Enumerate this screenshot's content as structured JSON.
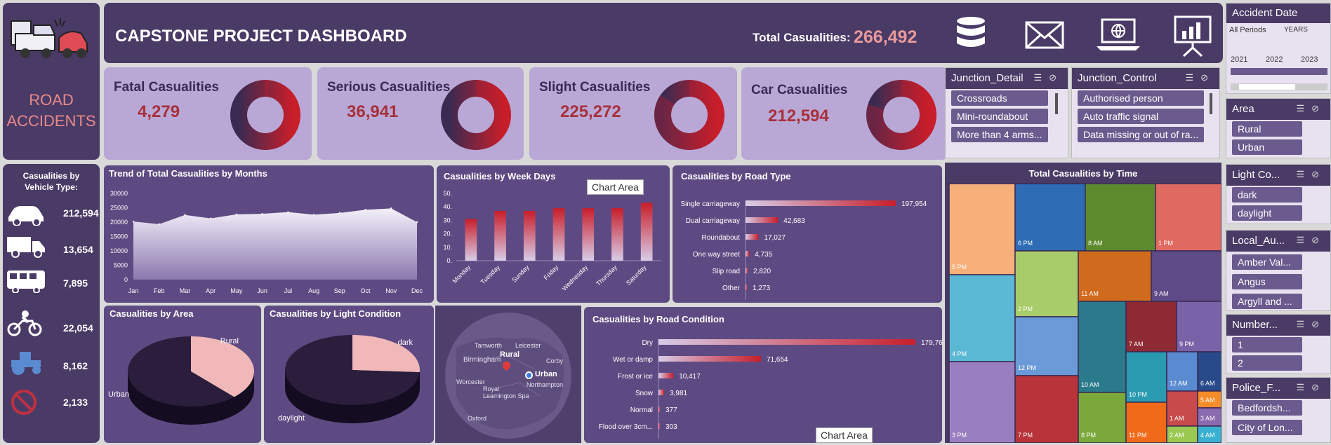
{
  "header": {
    "title": "CAPSTONE PROJECT DASHBOARD",
    "total_label": "Total Casualities:",
    "total_value": "266,492",
    "icons": [
      "database-icon",
      "mail-icon",
      "laptop-globe-icon",
      "presentation-icon"
    ]
  },
  "logo": {
    "line1": "ROAD",
    "line2": "ACCIDENTS"
  },
  "kpis": [
    {
      "label": "Fatal Casualities",
      "value": "4,279",
      "share": 0.016
    },
    {
      "label": "Serious Casualities",
      "value": "36,941",
      "share": 0.139
    },
    {
      "label": "Slight Casualities",
      "value": "225,272",
      "share": 0.845
    },
    {
      "label": "Car Casualities",
      "value": "212,594",
      "share": 0.798
    }
  ],
  "vehicle": {
    "title1": "Casualities by",
    "title2": "Vehicle Type:",
    "values": [
      "212,594",
      "13,654",
      "7,895",
      "22,054",
      "8,162",
      "2,133"
    ],
    "icons": [
      "car-icon",
      "van-icon",
      "bus-icon",
      "motorcycle-icon",
      "tractor-icon",
      "no-entry-icon"
    ]
  },
  "chart_area_label": "Chart Area",
  "slicers": {
    "accident_date": {
      "title": "Accident Date",
      "period": "All Periods",
      "level": "YEARS",
      "years": [
        "2021",
        "2022",
        "2023"
      ]
    },
    "junction_detail": {
      "title": "Junction_Detail",
      "items": [
        "Crossroads",
        "Mini-roundabout",
        "More than 4 arms..."
      ]
    },
    "junction_control": {
      "title": "Junction_Control",
      "items": [
        "Authorised person",
        "Auto traffic signal",
        "Data missing or out of ra..."
      ]
    },
    "area": {
      "title": "Area",
      "items": [
        "Rural",
        "Urban"
      ]
    },
    "light": {
      "title": "Light Co...",
      "items": [
        "dark",
        "daylight"
      ]
    },
    "local_authority": {
      "title": "Local_Au...",
      "items": [
        "Amber Val...",
        "Angus",
        "Argyll and ..."
      ]
    },
    "number": {
      "title": "Number...",
      "items": [
        "1",
        "2"
      ]
    },
    "police": {
      "title": "Police_F...",
      "items": [
        "Bedfordsh...",
        "City of Lon..."
      ]
    }
  },
  "map": {
    "labels": [
      "Tamworth",
      "Leicester",
      "Birmingham",
      "Rural",
      "Corby",
      "Worcester",
      "Royal Leamington Spa",
      "Urban",
      "Northampton",
      "Oxford"
    ]
  },
  "chart_data": [
    {
      "type": "area",
      "title": "Trend of Total Casualities by Months",
      "categories": [
        "Jan",
        "Feb",
        "Mar",
        "Apr",
        "May",
        "Jun",
        "Jul",
        "Aug",
        "Sep",
        "Oct",
        "Nov",
        "Dec"
      ],
      "values": [
        20200,
        19300,
        22500,
        21300,
        22700,
        22900,
        23500,
        22600,
        23200,
        24300,
        24800,
        20000
      ],
      "yticks": [
        "30000",
        "25000",
        "20000",
        "15000",
        "10000",
        "5000",
        "0"
      ],
      "ylim": [
        0,
        30000
      ]
    },
    {
      "type": "bar",
      "title": "Casualities by Week Days",
      "categories": [
        "Monday",
        "Tuesday",
        "Sunday",
        "Friday",
        "Wednesday",
        "Thursday",
        "Saturday"
      ],
      "values": [
        31,
        37,
        37,
        39,
        39,
        39,
        43
      ],
      "yticks": [
        "50.",
        "40.",
        "30.",
        "20.",
        "10.",
        "0."
      ],
      "ylim": [
        0,
        50
      ]
    },
    {
      "type": "bar",
      "orientation": "horizontal",
      "title": "Casualities by Road Type",
      "categories": [
        "Single carriageway",
        "Dual carriageway",
        "Roundabout",
        "One way street",
        "Slip road",
        "Other"
      ],
      "values": [
        197954,
        42683,
        17027,
        4735,
        2820,
        1273
      ],
      "labels": [
        "197,954",
        "42,683",
        "17,027",
        "4,735",
        "2,820",
        "1,273"
      ]
    },
    {
      "type": "pie",
      "title": "Casualities by Area",
      "categories": [
        "Rural",
        "Urban"
      ],
      "values": [
        38,
        62
      ]
    },
    {
      "type": "pie",
      "title": "Casualities by Light Condition",
      "categories": [
        "dark",
        "daylight"
      ],
      "values": [
        26,
        74
      ]
    },
    {
      "type": "bar",
      "orientation": "horizontal",
      "title": "Casualities by Road Condition",
      "categories": [
        "Dry",
        "Wet or damp",
        "Frost or ice",
        "Snow",
        "Normal",
        "Flood over 3cm..."
      ],
      "values": [
        179760,
        71654,
        10417,
        3981,
        377,
        303
      ],
      "labels": [
        "179,760",
        "71,654",
        "10,417",
        "3,981",
        "377",
        "303"
      ]
    },
    {
      "type": "treemap",
      "title": "Total Casualities by Time",
      "categories": [
        "5 PM",
        "6 PM",
        "8 AM",
        "1 PM",
        "4 PM",
        "2 PM",
        "11 AM",
        "9 AM",
        "3 PM",
        "12 PM",
        "10 AM",
        "7 AM",
        "9 PM",
        "7 PM",
        "8 PM",
        "10 PM",
        "12 AM",
        "6 AM",
        "11 PM",
        "1 AM",
        "5 AM",
        "3 AM",
        "2 AM",
        "4 AM"
      ],
      "colors": [
        "#f7b07a",
        "#2e6cb5",
        "#5e8a2e",
        "#e06a62",
        "#5bb8d4",
        "#a8cc6a",
        "#d06a1c",
        "#5e4a86",
        "#9a7fc0",
        "#6b9ad9",
        "#2a7a8c",
        "#8e2a33",
        "#7a62a8",
        "#b8343a",
        "#7aa83a",
        "#2a9ab0",
        "#5a8ad0",
        "#284a8a",
        "#f06a1a",
        "#c84a4a",
        "#f48c2a",
        "#8a6ab0",
        "#9ac850",
        "#3ab0d0"
      ]
    }
  ]
}
